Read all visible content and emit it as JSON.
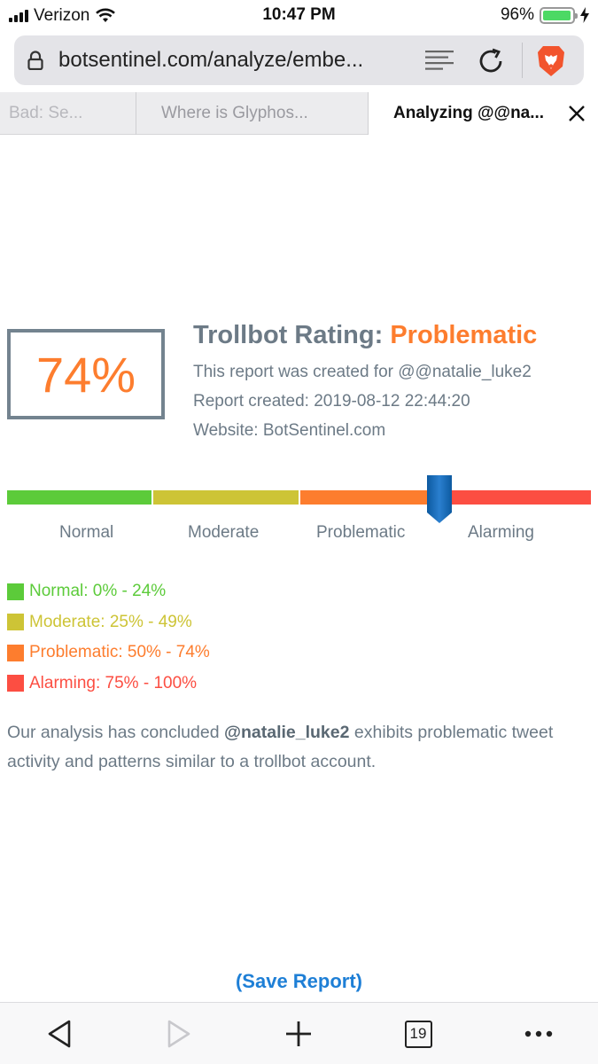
{
  "status_bar": {
    "carrier": "Verizon",
    "time": "10:47 PM",
    "battery": "96%",
    "battery_level": 0.96
  },
  "browser": {
    "url": "botsentinel.com/analyze/embe...",
    "tabs": [
      {
        "label": "Bad: Se..."
      },
      {
        "label": "Where is Glyphos..."
      },
      {
        "label": "Analyzing @@na...",
        "active": true
      }
    ],
    "tab_count": "19"
  },
  "report": {
    "score": "74%",
    "title_prefix": "Trollbot Rating:",
    "rating": "Problematic",
    "created_for": "This report was created for @@natalie_luke2",
    "created_at": "Report created: 2019-08-12 22:44:20",
    "website": "Website: BotSentinel.com",
    "marker_percent": 74
  },
  "scale": {
    "labels": [
      "Normal",
      "Moderate",
      "Problematic",
      "Alarming"
    ],
    "colors": [
      "#5ccb3a",
      "#cdc436",
      "#fd7d2e",
      "#fc4e42"
    ]
  },
  "legend": [
    {
      "text": "Normal: 0% - 24%",
      "color": "#5ccb3a"
    },
    {
      "text": "Moderate: 25% - 49%",
      "color": "#cdc436"
    },
    {
      "text": "Problematic: 50% - 74%",
      "color": "#fd7d2e"
    },
    {
      "text": "Alarming: 75% - 100%",
      "color": "#fc4e42"
    }
  ],
  "conclusion": {
    "before": "Our analysis has concluded ",
    "handle": "@natalie_luke2",
    "after": " exhibits problematic tweet activity and patterns similar to a trollbot account."
  },
  "save_label": "(Save Report)"
}
